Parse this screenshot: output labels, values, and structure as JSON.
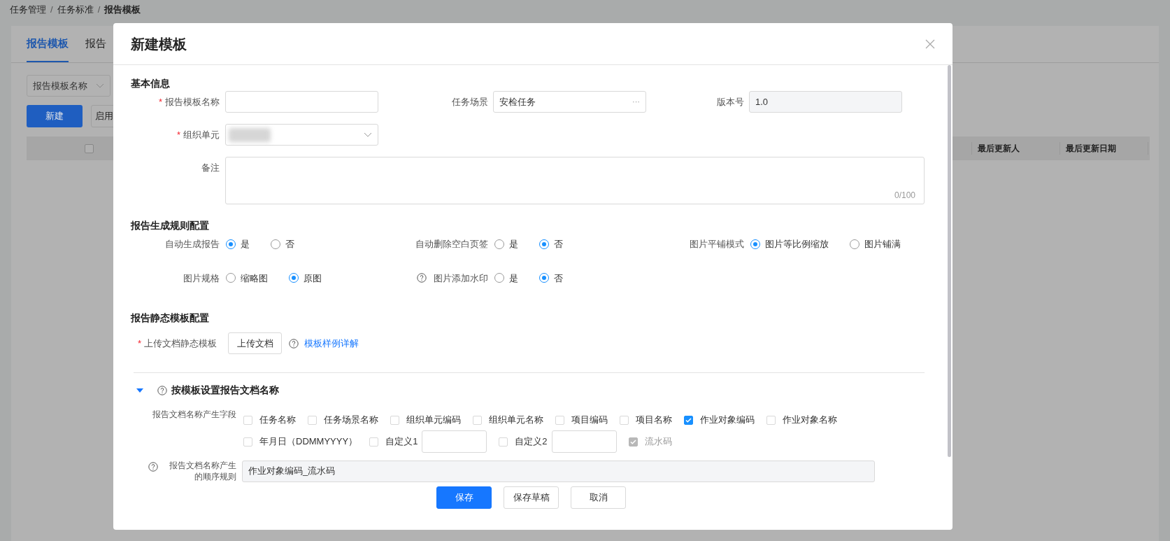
{
  "breadcrumb": {
    "items": [
      "任务管理",
      "任务标准",
      "报告模板"
    ],
    "separator": "/"
  },
  "background": {
    "tabs": [
      {
        "label": "报告模板",
        "selected": true
      },
      {
        "label": "报告",
        "selected": false
      }
    ],
    "filter_select": {
      "value": "报告模板名称"
    },
    "buttons": [
      {
        "label": "新建",
        "kind": "primary"
      },
      {
        "label": "启用",
        "kind": "default"
      }
    ],
    "table": {
      "header_checkbox": {
        "checked": false
      },
      "columns": [
        "最后更新人",
        "最后更新日期"
      ]
    }
  },
  "modal": {
    "title": "新建模板",
    "basic": {
      "title": "基本信息",
      "template_name": {
        "label": "报告模板名称",
        "required_mark": "*"
      },
      "task_scene": {
        "label": "任务场景",
        "value": "安检任务",
        "more": "···"
      },
      "version": {
        "label": "版本号",
        "value": "1.0"
      },
      "org_unit": {
        "label": "组织单元",
        "required_mark": "*"
      },
      "remark": {
        "label": "备注",
        "counter": "0/100"
      }
    },
    "rules": {
      "title": "报告生成规则配置",
      "rows": [
        [
          {
            "label": "自动生成报告",
            "options": [
              {
                "label": "是",
                "selected": true
              },
              {
                "label": "否",
                "selected": false
              }
            ]
          },
          {
            "label": "自动删除空白页签",
            "options": [
              {
                "label": "是",
                "selected": false
              },
              {
                "label": "否",
                "selected": true
              }
            ]
          },
          {
            "label": "图片平铺模式",
            "options": [
              {
                "label": "图片等比例缩放",
                "selected": true
              },
              {
                "label": "图片铺满",
                "selected": false
              }
            ]
          }
        ],
        [
          {
            "label": "图片规格",
            "options": [
              {
                "label": "缩略图",
                "selected": false
              },
              {
                "label": "原图",
                "selected": true
              }
            ]
          },
          {
            "label": "图片添加水印",
            "help": true,
            "options": [
              {
                "label": "是",
                "selected": false
              },
              {
                "label": "否",
                "selected": true
              }
            ]
          }
        ]
      ]
    },
    "static": {
      "title": "报告静态模板配置",
      "label": "上传文档静态模板",
      "required_mark": "*",
      "upload_button": "上传文档",
      "link": "模板样例详解"
    },
    "naming": {
      "title": "按模板设置报告文档名称",
      "expanded": true,
      "fields_label": "报告文档名称产生字段",
      "field_rows": [
        [
          {
            "label": "任务名称",
            "checked": false,
            "disabled": false,
            "kind": "plain"
          },
          {
            "label": "任务场景名称",
            "checked": false,
            "disabled": false,
            "kind": "plain"
          },
          {
            "label": "组织单元编码",
            "checked": false,
            "disabled": false,
            "kind": "plain"
          },
          {
            "label": "组织单元名称",
            "checked": false,
            "disabled": false,
            "kind": "plain"
          },
          {
            "label": "项目编码",
            "checked": false,
            "disabled": false,
            "kind": "plain"
          },
          {
            "label": "项目名称",
            "checked": false,
            "disabled": false,
            "kind": "plain"
          },
          {
            "label": "作业对象编码",
            "checked": true,
            "disabled": false,
            "kind": "plain"
          },
          {
            "label": "作业对象名称",
            "checked": false,
            "disabled": false,
            "kind": "plain"
          }
        ],
        [
          {
            "label": "年月日（DDMMYYYY）",
            "checked": false,
            "disabled": false,
            "kind": "plain"
          },
          {
            "label": "自定义1",
            "checked": false,
            "disabled": false,
            "kind": "input"
          },
          {
            "label": "自定义2",
            "checked": false,
            "disabled": false,
            "kind": "input"
          },
          {
            "label": "流水码",
            "checked": true,
            "disabled": true,
            "kind": "plain"
          }
        ]
      ],
      "order_label": "报告文档名称产生的顺序规则",
      "order_value": "作业对象编码_流水码"
    },
    "footer": [
      {
        "label": "保存",
        "kind": "primary"
      },
      {
        "label": "保存草稿",
        "kind": "default"
      },
      {
        "label": "取消",
        "kind": "default"
      }
    ]
  }
}
